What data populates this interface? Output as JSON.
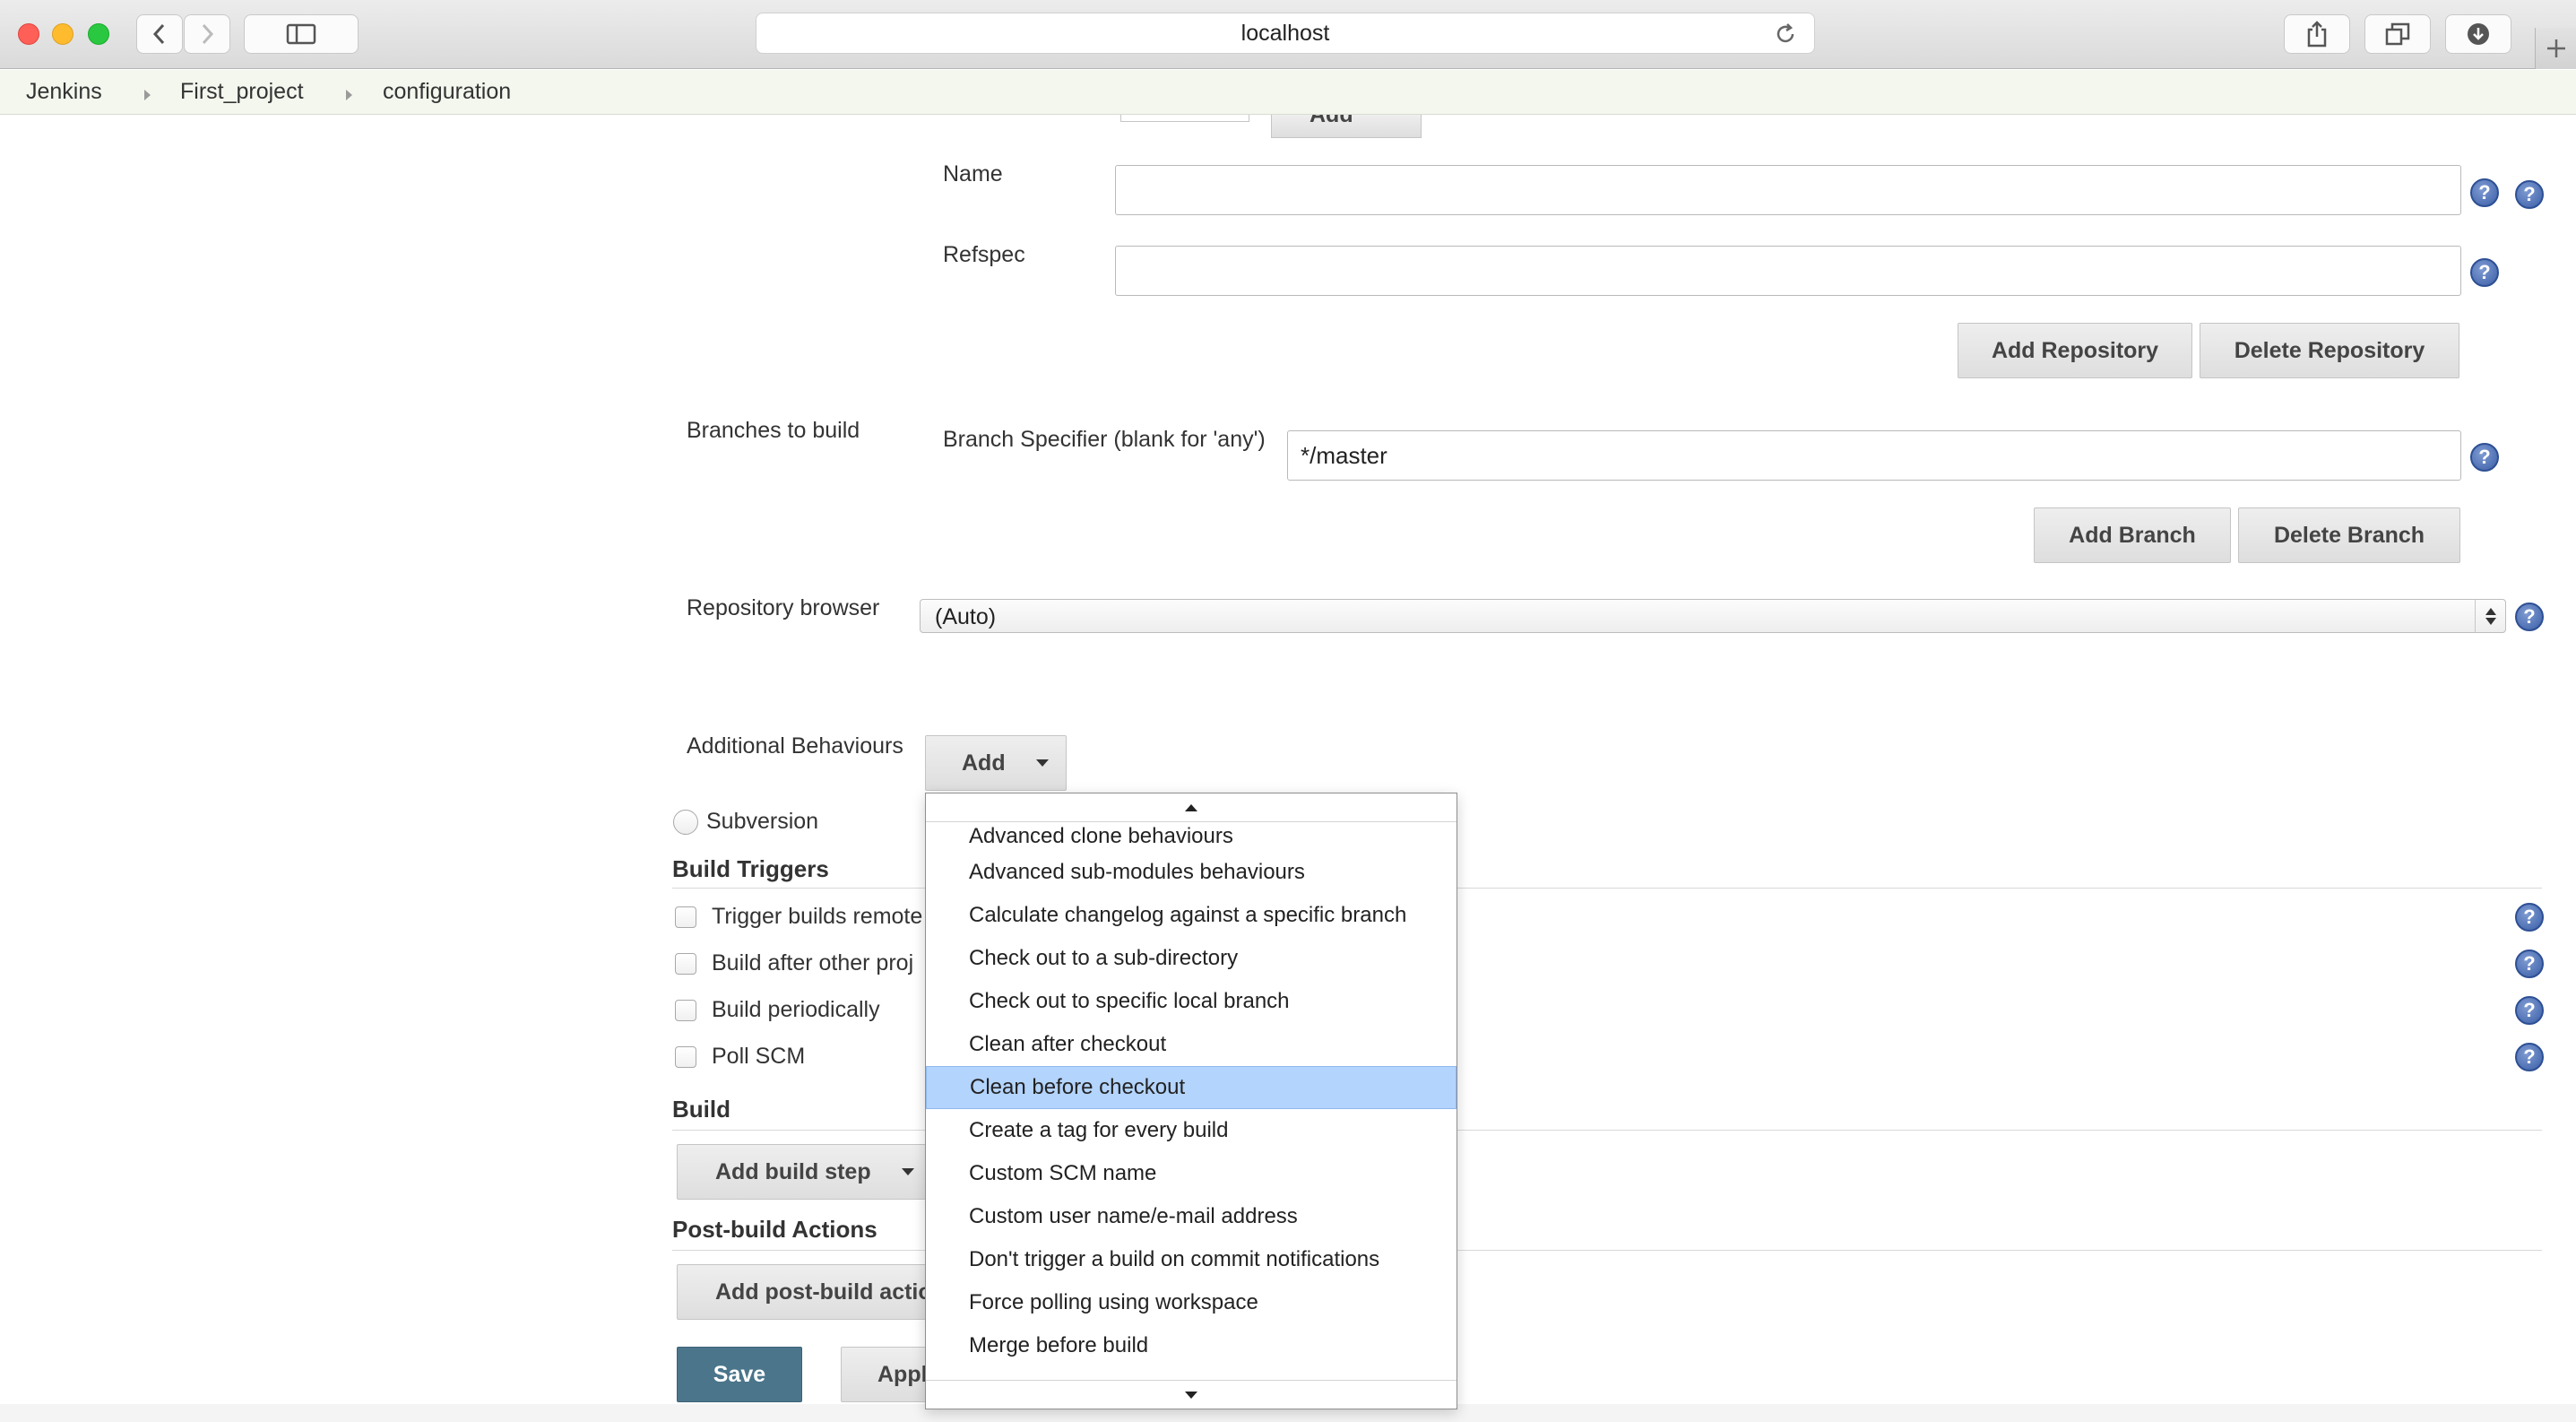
{
  "browser": {
    "url": "localhost"
  },
  "breadcrumb": [
    "Jenkins",
    "First_project",
    "configuration"
  ],
  "repository": {
    "add_label": "Add",
    "name_label": "Name",
    "name_value": "",
    "refspec_label": "Refspec",
    "refspec_value": "",
    "add_repository": "Add Repository",
    "delete_repository": "Delete Repository"
  },
  "branches": {
    "section_label": "Branches to build",
    "specifier_label": "Branch Specifier (blank for 'any')",
    "specifier_value": "*/master",
    "add_branch": "Add Branch",
    "delete_branch": "Delete Branch"
  },
  "repo_browser": {
    "label": "Repository browser",
    "selected": "(Auto)"
  },
  "additional_behaviours": {
    "label": "Additional Behaviours",
    "add_button": "Add",
    "menu_items": [
      "Advanced clone behaviours",
      "Advanced sub-modules behaviours",
      "Calculate changelog against a specific branch",
      "Check out to a sub-directory",
      "Check out to specific local branch",
      "Clean after checkout",
      "Clean before checkout",
      "Create a tag for every build",
      "Custom SCM name",
      "Custom user name/e-mail address",
      "Don't trigger a build on commit notifications",
      "Force polling using workspace",
      "Merge before build"
    ],
    "highlighted": "Clean before checkout"
  },
  "scm_subversion": "Subversion",
  "build_triggers": {
    "title": "Build Triggers",
    "items": [
      "Trigger builds remote",
      "Build after other proj",
      "Build periodically",
      "Poll SCM"
    ]
  },
  "build": {
    "title": "Build",
    "add_step": "Add build step"
  },
  "post_build": {
    "title": "Post-build Actions",
    "add_action": "Add post-build actio"
  },
  "footer": {
    "save": "Save",
    "apply": "Appl"
  },
  "colors": {
    "save_button": "#4b758b",
    "highlight": "#b3d4fd",
    "breadcrumb_bg": "#f3f7ee"
  }
}
